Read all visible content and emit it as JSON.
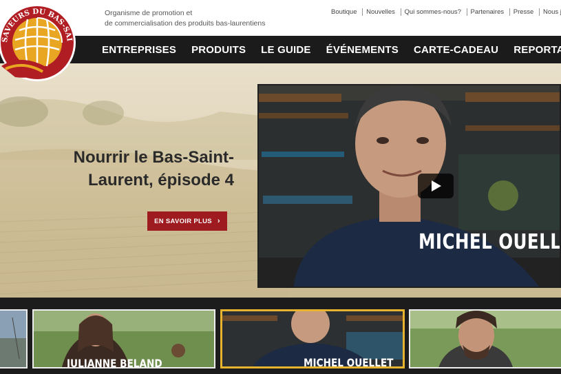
{
  "brand": {
    "logo_text": "SAVEURS DU BAS-SAINT-LAURENT",
    "tagline_line1": "Organisme de promotion et",
    "tagline_line2": "de commercialisation des produits bas-laurentiens"
  },
  "utility_nav": [
    "Boutique",
    "Nouvelles",
    "Qui sommes-nous?",
    "Partenaires",
    "Presse",
    "Nous joindre"
  ],
  "main_nav": [
    "ENTREPRISES",
    "PRODUITS",
    "LE GUIDE",
    "ÉVÉNEMENTS",
    "CARTE-CADEAU",
    "REPORTAGES"
  ],
  "hero": {
    "title_line1": "Nourrir le Bas-Saint-",
    "title_line2": "Laurent, épisode 4",
    "cta_label": "EN SAVOIR PLUS",
    "cta_chevron": "›",
    "video_caption": "MICHEL OUELLET"
  },
  "thumbnails": [
    {
      "caption": ""
    },
    {
      "caption": "JULIANNE BELAND"
    },
    {
      "caption": "MICHEL OUELLET"
    },
    {
      "caption": ""
    }
  ],
  "colors": {
    "nav_bg": "#1b1b1b",
    "cta_red": "#9e1b20",
    "active_thumb_border": "#e8b430",
    "logo_red": "#b01e23",
    "logo_gold": "#e9a623"
  }
}
